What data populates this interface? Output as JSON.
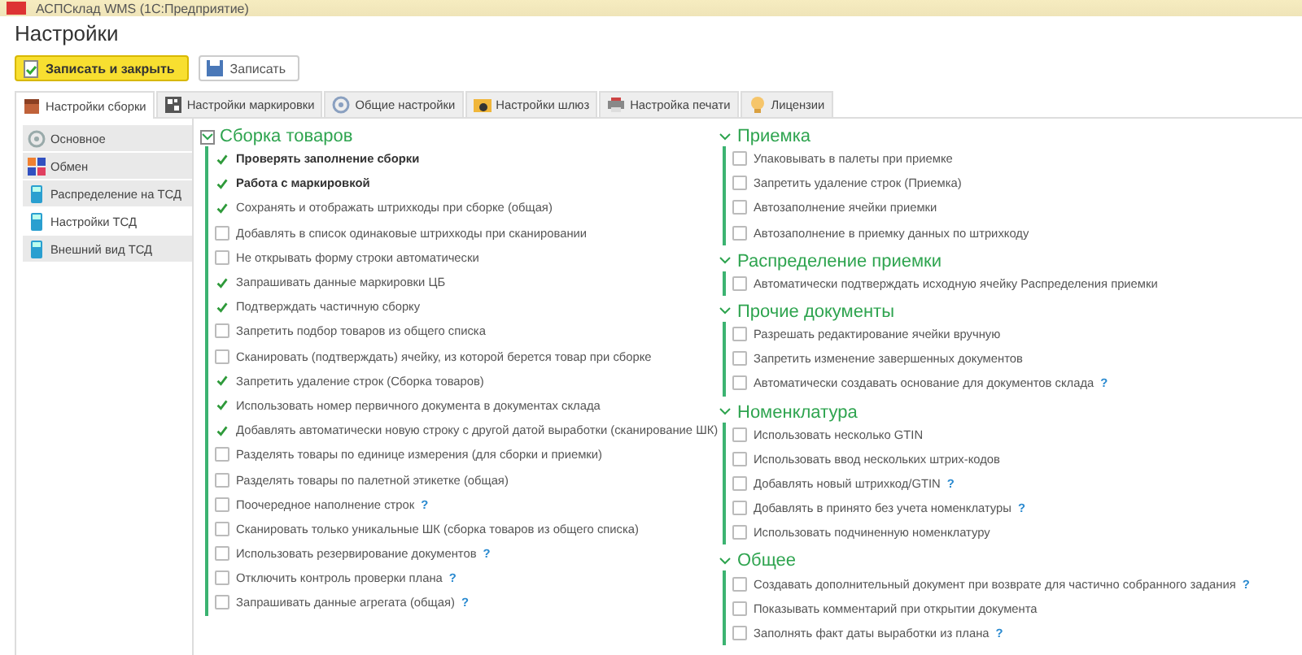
{
  "window": {
    "title": "АСПСклад WMS (1С:Предприятие)"
  },
  "page_title": "Настройки",
  "buttons": [
    {
      "label": "Записать и закрыть",
      "kind": "primary"
    },
    {
      "label": "Записать",
      "kind": "secondary"
    }
  ],
  "tabs": [
    {
      "label": "Настройки сборки",
      "selected": true
    },
    {
      "label": "Настройки маркировки",
      "selected": false
    },
    {
      "label": "Общие настройки",
      "selected": false
    },
    {
      "label": "Настройки шлюз",
      "selected": false
    },
    {
      "label": "Настройка печати",
      "selected": false
    },
    {
      "label": "Лицензии",
      "selected": false
    }
  ],
  "sidebar": {
    "items": [
      {
        "label": "Основное",
        "selected": false
      },
      {
        "label": "Обмен",
        "selected": false
      },
      {
        "label": "Распределение на ТСД",
        "selected": false
      },
      {
        "label": "Настройки ТСД",
        "selected": true
      },
      {
        "label": "Внешний вид ТСД",
        "selected": false
      }
    ]
  },
  "columns": [
    {
      "groups": [
        {
          "title": "Сборка товаров",
          "expanded": true,
          "focused": true,
          "items": [
            {
              "label": "Проверять заполнение сборки",
              "checked": true,
              "bold": true
            },
            {
              "label": "Работа с маркировкой",
              "checked": true,
              "bold": true
            },
            {
              "label": "Сохранять  и отображать штрихкоды при сборке (общая)",
              "checked": true,
              "bold": false
            },
            {
              "label": "Добавлять в список одинаковые штрихкоды при сканировании",
              "checked": false,
              "bold": false
            },
            {
              "label": "Не открывать форму строки автоматически",
              "checked": false,
              "bold": false
            },
            {
              "label": "Запрашивать данные маркировки ЦБ",
              "checked": true,
              "bold": false
            },
            {
              "label": "Подтверждать частичную сборку",
              "checked": true,
              "bold": false
            },
            {
              "label": "Запретить подбор товаров из общего списка",
              "checked": false,
              "bold": false
            },
            {
              "label": "Сканировать (подтверждать) ячейку, из которой берется товар при сборке",
              "checked": false,
              "bold": false
            },
            {
              "label": "Запретить удаление строк (Сборка товаров)",
              "checked": true,
              "bold": false
            },
            {
              "label": "Использовать номер первичного документа в документах склада",
              "checked": true,
              "bold": false
            },
            {
              "label": "Добавлять автоматически новую строку с другой датой выработки (сканирование ШК)",
              "checked": true,
              "bold": false
            },
            {
              "label": "Разделять товары по единице измерения (для сборки и приемки)",
              "checked": false,
              "bold": false
            },
            {
              "label": "Разделять товары по палетной этикетке (общая)",
              "checked": false,
              "bold": false
            },
            {
              "label": "Поочередное наполнение строк",
              "checked": false,
              "bold": false,
              "hint": "?"
            },
            {
              "label": "Сканировать только уникальные ШК (сборка товаров из общего списка)",
              "checked": false,
              "bold": false
            },
            {
              "label": "Использовать резервирование документов",
              "checked": false,
              "bold": false,
              "hint": "?"
            },
            {
              "label": "Отключить контроль проверки плана",
              "checked": false,
              "bold": false,
              "hint": "?"
            },
            {
              "label": "Запрашивать данные агрегата (общая)",
              "checked": false,
              "bold": false,
              "hint": "?"
            }
          ]
        }
      ]
    },
    {
      "groups": [
        {
          "title": "Приемка",
          "expanded": true,
          "focused": false,
          "items": [
            {
              "label": "Упаковывать в палеты при приемке",
              "checked": false,
              "bold": false
            },
            {
              "label": "Запретить удаление строк (Приемка)",
              "checked": false,
              "bold": false
            },
            {
              "label": "Автозаполнение ячейки приемки",
              "checked": false,
              "bold": false
            },
            {
              "label": "Автозаполнение в приемку данных по штрихкоду",
              "checked": false,
              "bold": false
            }
          ]
        },
        {
          "title": "Распределение приемки",
          "expanded": true,
          "focused": false,
          "items": [
            {
              "label": "Автоматически подтверждать исходную ячейку Распределения приемки",
              "checked": false,
              "bold": false
            }
          ]
        },
        {
          "title": "Прочие документы",
          "expanded": true,
          "focused": false,
          "items": [
            {
              "label": "Разрешать редактирование ячейки вручную",
              "checked": false,
              "bold": false
            },
            {
              "label": "Запретить изменение завершенных документов",
              "checked": false,
              "bold": false
            },
            {
              "label": "Автоматически создавать основание для документов склада",
              "checked": false,
              "bold": false,
              "hint": "?"
            }
          ]
        },
        {
          "title": "Номенклатура",
          "expanded": true,
          "focused": false,
          "items": [
            {
              "label": "Использовать несколько GTIN",
              "checked": false,
              "bold": false
            },
            {
              "label": "Использовать ввод нескольких штрих-кодов",
              "checked": false,
              "bold": false
            },
            {
              "label": "Добавлять новый штрихкод/GTIN",
              "checked": false,
              "bold": false,
              "hint": "?"
            },
            {
              "label": "Добавлять в принято без учета номенклатуры",
              "checked": false,
              "bold": false,
              "hint": "?"
            },
            {
              "label": "Использовать подчиненную номенклатуру",
              "checked": false,
              "bold": false
            }
          ]
        },
        {
          "title": "Общее",
          "expanded": true,
          "focused": false,
          "items": [
            {
              "label": "Создавать дополнительный документ при возврате для частично собранного задания",
              "checked": false,
              "bold": false,
              "hint": "?"
            },
            {
              "label": "Показывать комментарий при открытии документа",
              "checked": false,
              "bold": false
            },
            {
              "label": "Заполнять факт даты выработки из плана",
              "checked": false,
              "bold": false,
              "hint": "?"
            }
          ]
        }
      ]
    }
  ]
}
